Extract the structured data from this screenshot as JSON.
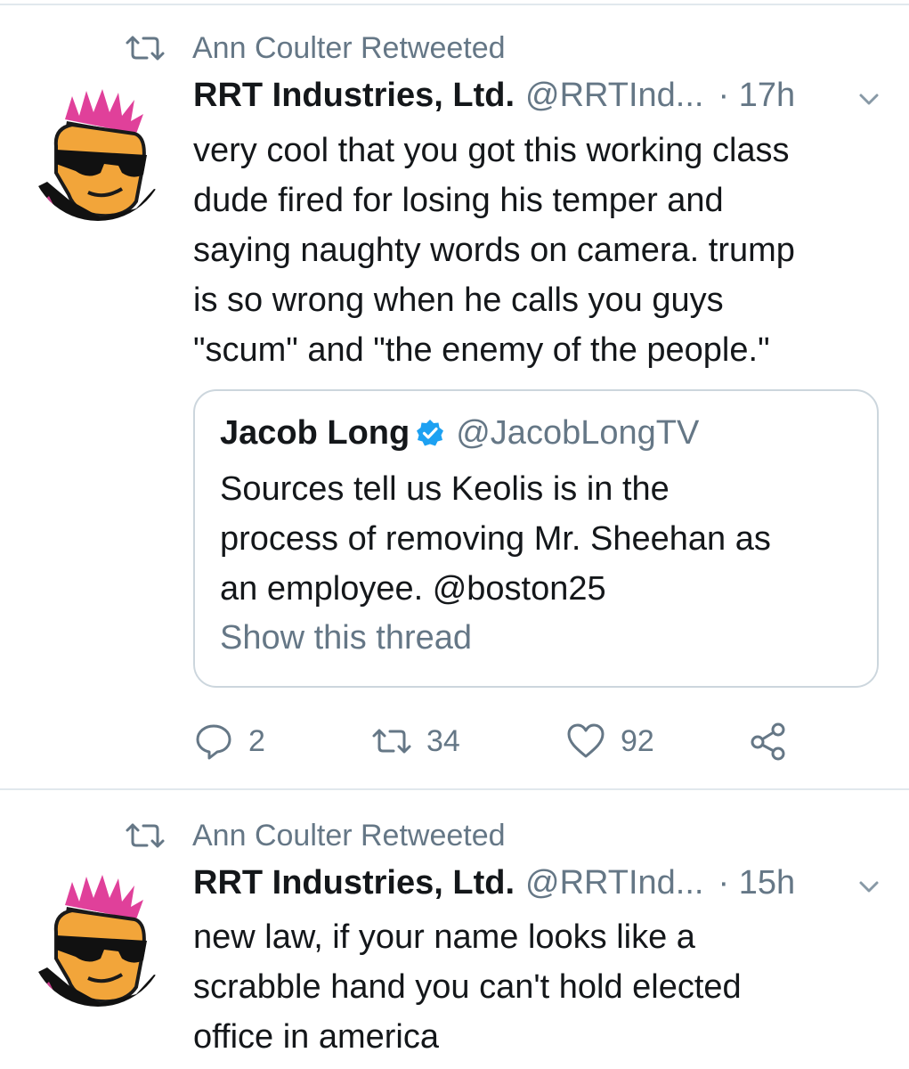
{
  "tweets": [
    {
      "retweeted_by": "Ann Coulter Retweeted",
      "name": "RRT Industries, Ltd.",
      "handle": "@RRTInd...",
      "time": "· 17h",
      "lines": [
        "very cool that you got this working class",
        "dude fired for losing his temper and",
        "saying naughty words on camera. trump",
        "is so wrong when he calls you guys",
        "\"scum\" and \"the enemy of the people.\""
      ],
      "quoted": {
        "name": "Jacob Long",
        "handle": "@JacobLongTV",
        "lines": [
          "Sources tell us Keolis is in the",
          "process of removing Mr. Sheehan as",
          "an employee. @boston25"
        ],
        "show_thread": "Show this thread"
      },
      "actions": {
        "replies": "2",
        "retweets": "34",
        "likes": "92"
      }
    },
    {
      "retweeted_by": "Ann Coulter Retweeted",
      "name": "RRT Industries, Ltd.",
      "handle": "@RRTInd...",
      "time": "· 15h",
      "lines": [
        "new law, if your name looks like a",
        "scrabble hand you can't hold elected",
        "office in america"
      ]
    }
  ],
  "icons": {
    "retweet": "retweet-icon",
    "caret": "chevron-down-icon",
    "verified": "verified-badge-icon",
    "reply": "reply-icon",
    "like": "heart-icon",
    "share": "share-icon"
  },
  "colors": {
    "text_primary": "#14171a",
    "text_secondary": "#657786",
    "border": "#ccd6dd",
    "verified": "#1da1f2"
  }
}
